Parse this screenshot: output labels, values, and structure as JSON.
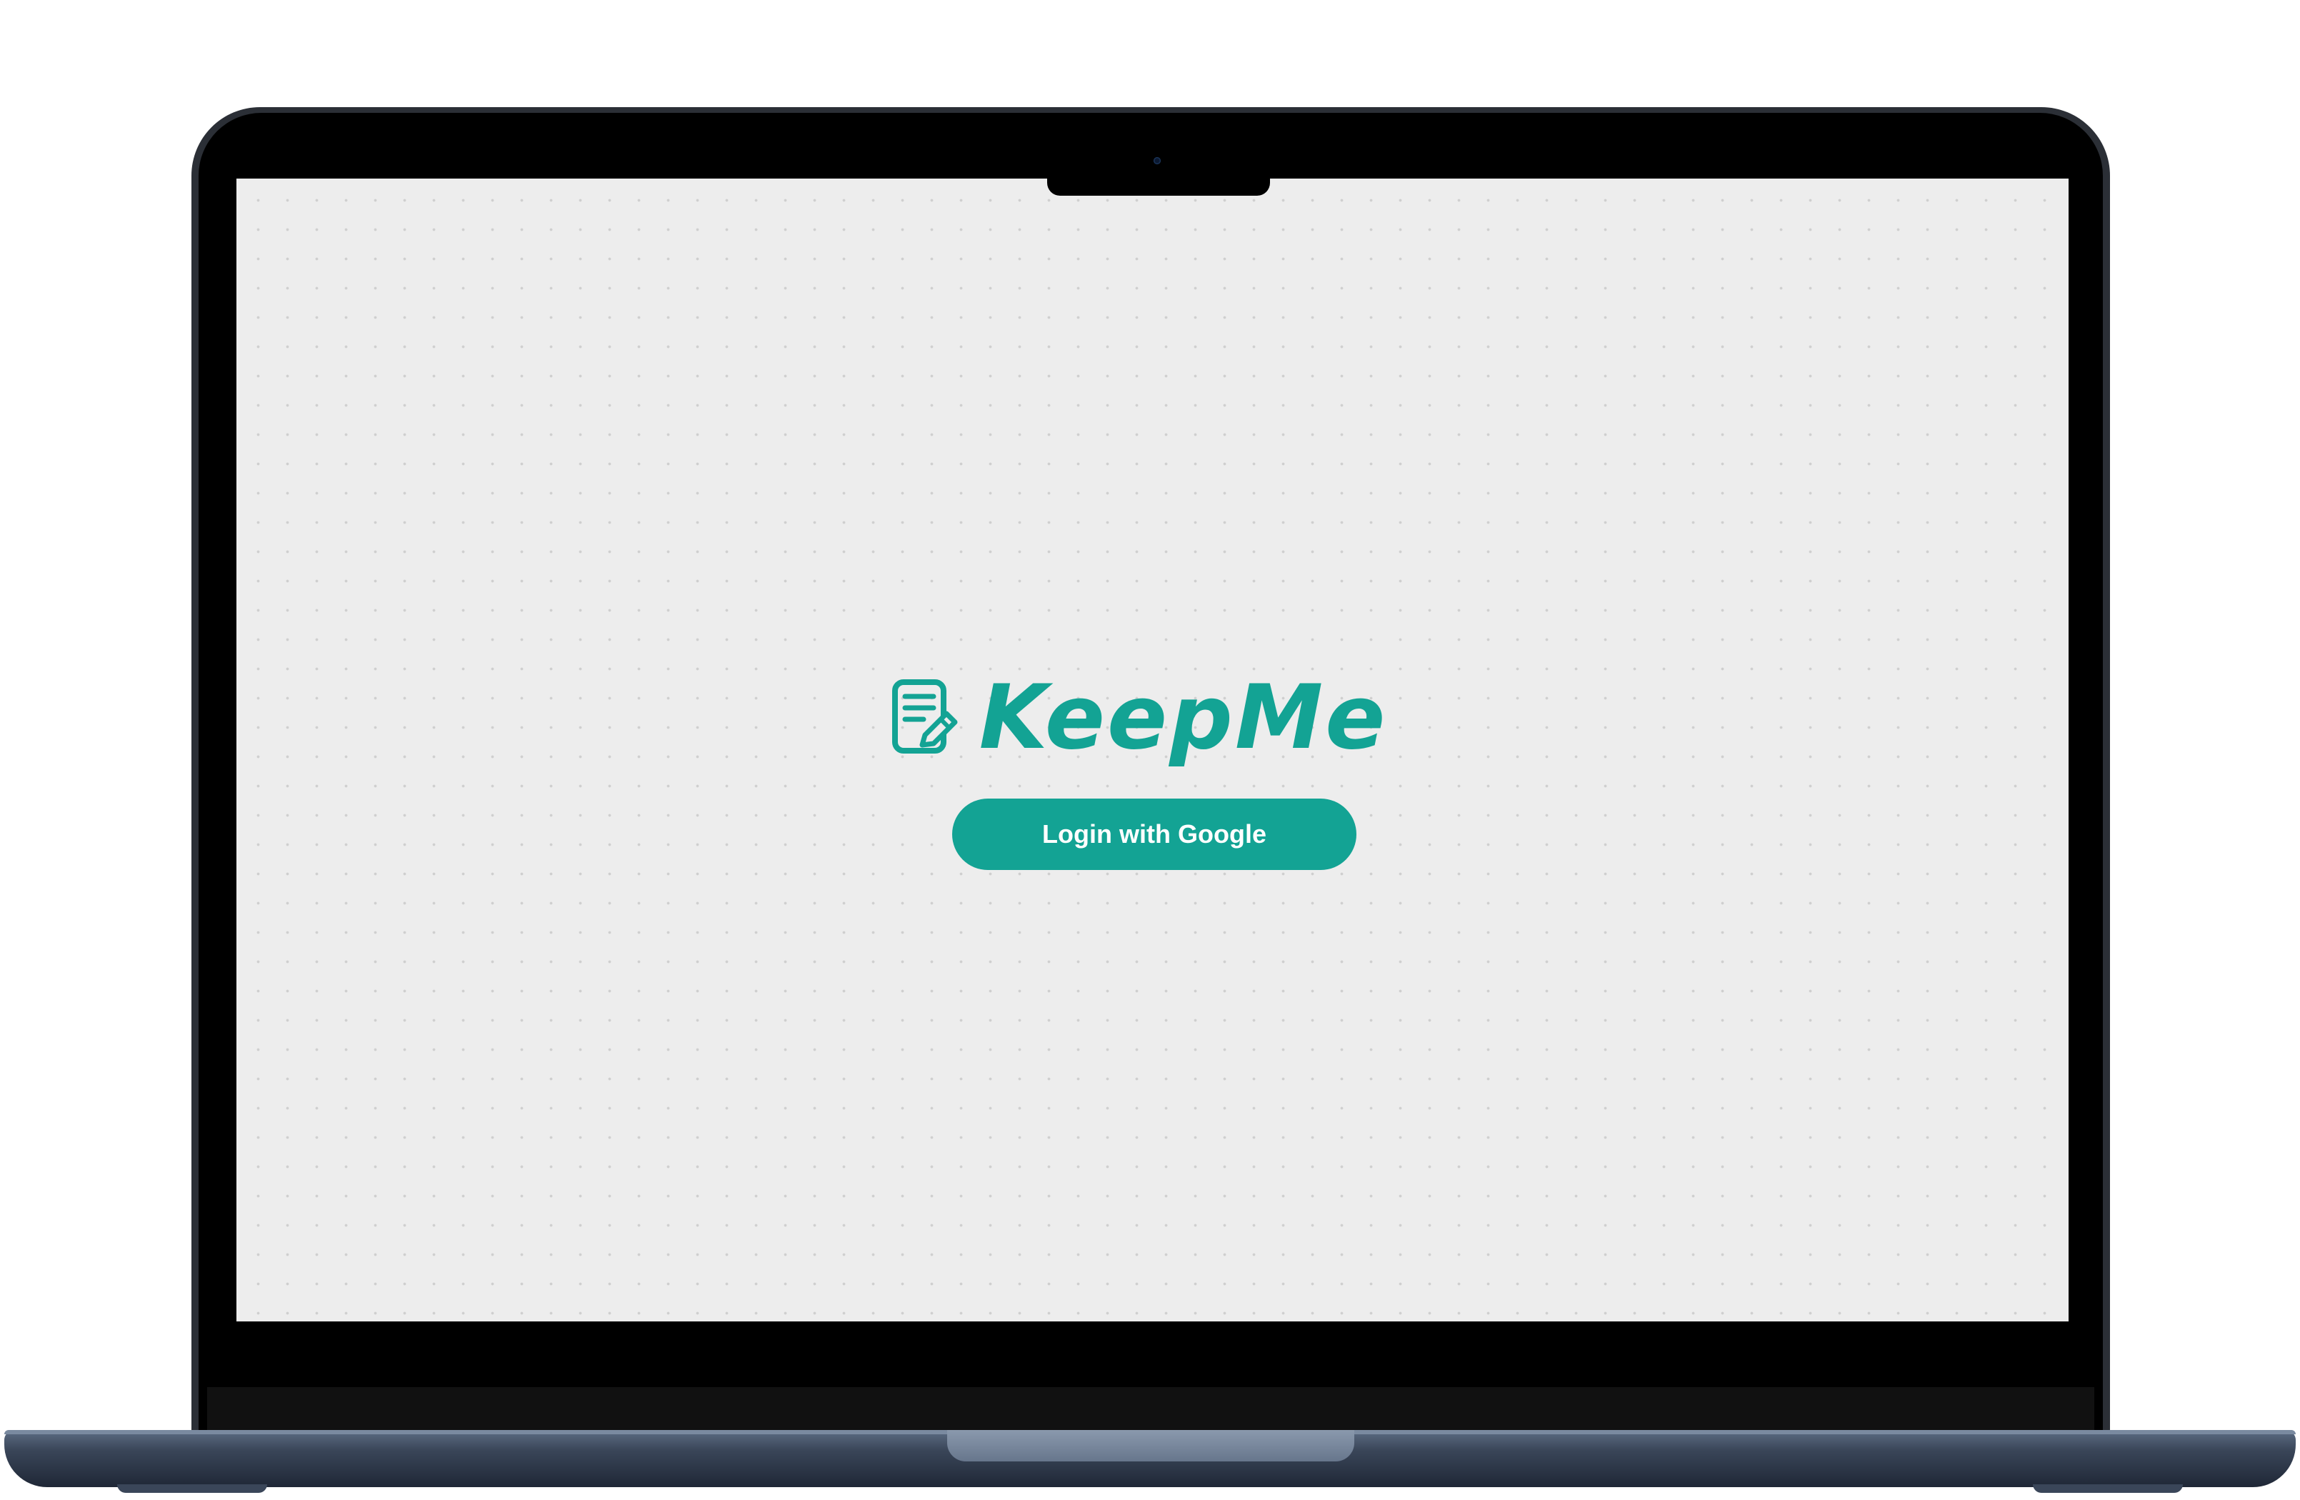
{
  "app": {
    "name": "KeepMe",
    "brand_color": "#13a394",
    "background_color": "#ededed",
    "logo_icon": "note-edit-icon"
  },
  "login": {
    "button_label": "Login with Google"
  }
}
